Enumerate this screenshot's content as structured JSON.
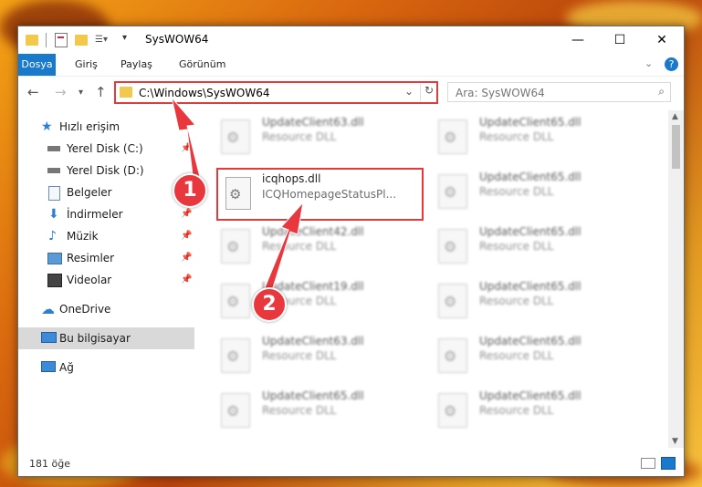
{
  "window": {
    "title": "SysWOW64"
  },
  "ribbon": {
    "tabs": [
      "Dosya",
      "Giriş",
      "Paylaş",
      "Görünüm"
    ]
  },
  "address": {
    "path": "C:\\Windows\\SysWOW64"
  },
  "search": {
    "placeholder": "Ara: SysWOW64"
  },
  "sidebar": {
    "items": [
      {
        "label": "Hızlı erişim",
        "icon": "star-icon"
      },
      {
        "label": "Yerel Disk (C:)",
        "icon": "drive-icon",
        "pinned": true
      },
      {
        "label": "Yerel Disk (D:)",
        "icon": "drive-icon",
        "pinned": true
      },
      {
        "label": "Belgeler",
        "icon": "documents-icon",
        "pinned": true
      },
      {
        "label": "İndirmeler",
        "icon": "download-icon",
        "pinned": true
      },
      {
        "label": "Müzik",
        "icon": "music-icon",
        "pinned": true
      },
      {
        "label": "Resimler",
        "icon": "pictures-icon",
        "pinned": true
      },
      {
        "label": "Videolar",
        "icon": "videos-icon",
        "pinned": true
      },
      {
        "label": "OneDrive",
        "icon": "cloud-icon"
      },
      {
        "label": "Bu bilgisayar",
        "icon": "computer-icon",
        "selected": true
      },
      {
        "label": "Ağ",
        "icon": "network-icon"
      }
    ]
  },
  "files": {
    "highlighted": {
      "name": "icqhops.dll",
      "desc": "ICQHomepageStatusPl..."
    },
    "left_column": [
      {
        "name": "UpdateClient63.dll",
        "desc": "Resource DLL"
      },
      {
        "name": "UpdateClient42.dll",
        "desc": "Resource DLL"
      },
      {
        "name": "UpdateClient19.dll",
        "desc": "Resource DLL"
      },
      {
        "name": "UpdateClient63.dll",
        "desc": "Resource DLL"
      },
      {
        "name": "UpdateClient65.dll",
        "desc": "Resource DLL"
      }
    ],
    "right_column": [
      {
        "name": "UpdateClient65.dll",
        "desc": "Resource DLL"
      },
      {
        "name": "UpdateClient65.dll",
        "desc": "Resource DLL"
      },
      {
        "name": "UpdateClient65.dll",
        "desc": "Resource DLL"
      },
      {
        "name": "UpdateClient65.dll",
        "desc": "Resource DLL"
      },
      {
        "name": "UpdateClient65.dll",
        "desc": "Resource DLL"
      },
      {
        "name": "UpdateClient65.dll",
        "desc": "Resource DLL"
      }
    ]
  },
  "status": {
    "count": "181 öğe"
  },
  "annotations": {
    "badge1": "1",
    "badge2": "2"
  },
  "colors": {
    "accent": "#1979ca",
    "highlight": "#e23b3b"
  }
}
